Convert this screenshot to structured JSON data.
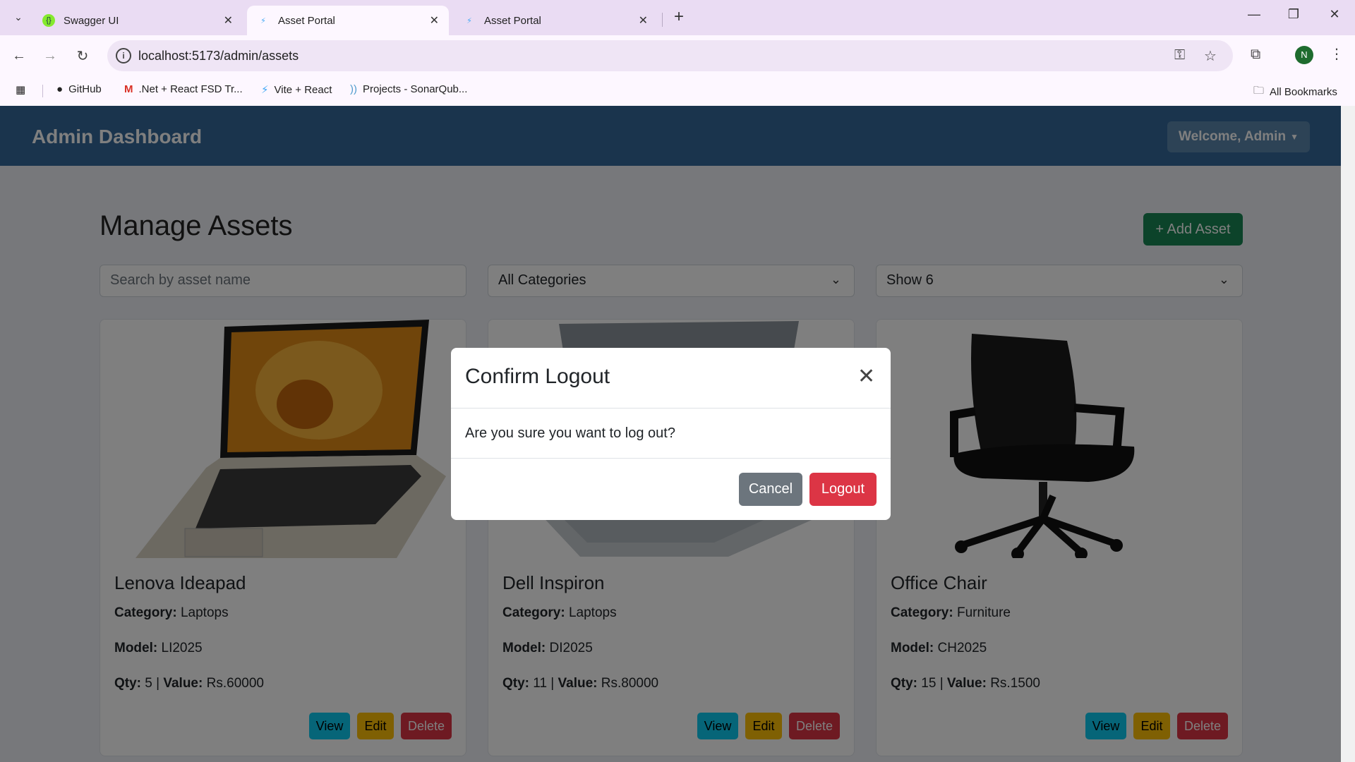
{
  "browser": {
    "tabs": [
      {
        "title": "Swagger UI"
      },
      {
        "title": "Asset Portal"
      },
      {
        "title": "Asset Portal"
      }
    ],
    "url": "localhost:5173/admin/assets",
    "profile_initial": "N",
    "bookmarks": [
      {
        "label": "GitHub",
        "icon": "github-icon"
      },
      {
        "label": ".Net + React FSD Tr...",
        "icon": "gmail-icon"
      },
      {
        "label": "Vite + React",
        "icon": "vite-icon"
      },
      {
        "label": "Projects - SonarQub...",
        "icon": "sonarqube-icon"
      }
    ],
    "all_bookmarks": "All Bookmarks"
  },
  "navbar": {
    "brand": "Admin Dashboard",
    "user_menu": "Welcome, Admin"
  },
  "main": {
    "title": "Manage Assets",
    "add_button": "+ Add Asset",
    "search_placeholder": "Search by asset name",
    "category_filter": "All Categories",
    "page_size": "Show 6"
  },
  "assets": [
    {
      "name": "Lenova Ideapad",
      "category_label": "Category:",
      "category": "Laptops",
      "model_label": "Model:",
      "model": "LI2025",
      "qty_label": "Qty:",
      "qty": "5",
      "value_label": "Value:",
      "value": "Rs.60000"
    },
    {
      "name": "Dell Inspiron",
      "category_label": "Category:",
      "category": "Laptops",
      "model_label": "Model:",
      "model": "DI2025",
      "qty_label": "Qty:",
      "qty": "11",
      "value_label": "Value:",
      "value": "Rs.80000"
    },
    {
      "name": "Office Chair",
      "category_label": "Category:",
      "category": "Furniture",
      "model_label": "Model:",
      "model": "CH2025",
      "qty_label": "Qty:",
      "qty": "15",
      "value_label": "Value:",
      "value": "Rs.1500"
    }
  ],
  "card_actions": {
    "view": "View",
    "edit": "Edit",
    "delete": "Delete"
  },
  "modal": {
    "title": "Confirm Logout",
    "body": "Are you sure you want to log out?",
    "cancel": "Cancel",
    "confirm": "Logout"
  },
  "colors": {
    "navbar": "#34699a",
    "primary_green": "#198754",
    "info": "#0dcaf0",
    "warning": "#ffc107",
    "danger": "#dc3545",
    "secondary": "#6c757d"
  }
}
